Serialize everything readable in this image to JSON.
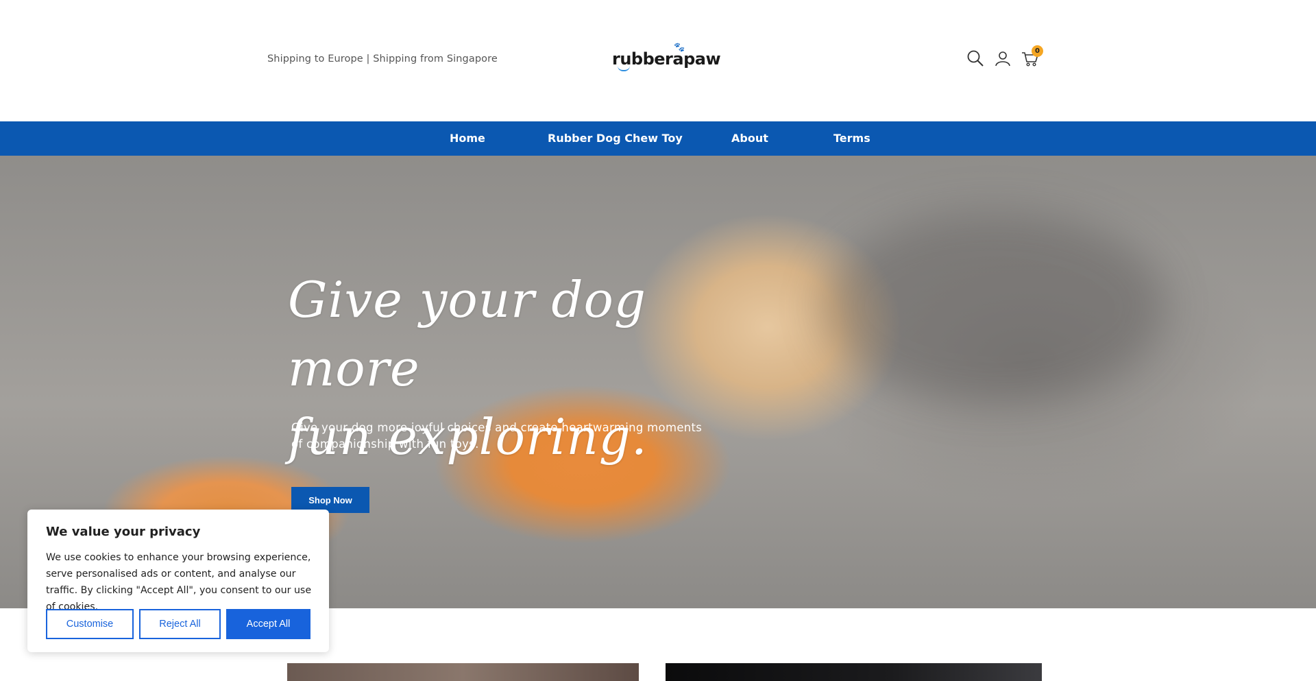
{
  "header": {
    "shipping_text": "Shipping to Europe | Shipping from Singapore",
    "logo_text": "rubberapaw",
    "cart_count": "0"
  },
  "nav": {
    "items": [
      {
        "label": "Home"
      },
      {
        "label": "Rubber Dog Chew Toy"
      },
      {
        "label": "About"
      },
      {
        "label": "Terms"
      }
    ]
  },
  "hero": {
    "title_line1": "Give your dog more",
    "title_line2": "fun exploring.",
    "subtitle": "Give your dog more joyful choices and create heartwarming moments of companionship with fun toys.",
    "button_label": "Shop Now"
  },
  "cookie": {
    "title": "We value your privacy",
    "text": "We use cookies to enhance your browsing experience, serve personalised ads or content, and analyse our traffic. By clicking \"Accept All\", you consent to our use of cookies.",
    "customise_label": "Customise",
    "reject_label": "Reject All",
    "accept_label": "Accept All"
  },
  "colors": {
    "brand_blue": "#0b58b1",
    "cookie_blue": "#1863dc",
    "badge_orange": "#f5a623"
  }
}
